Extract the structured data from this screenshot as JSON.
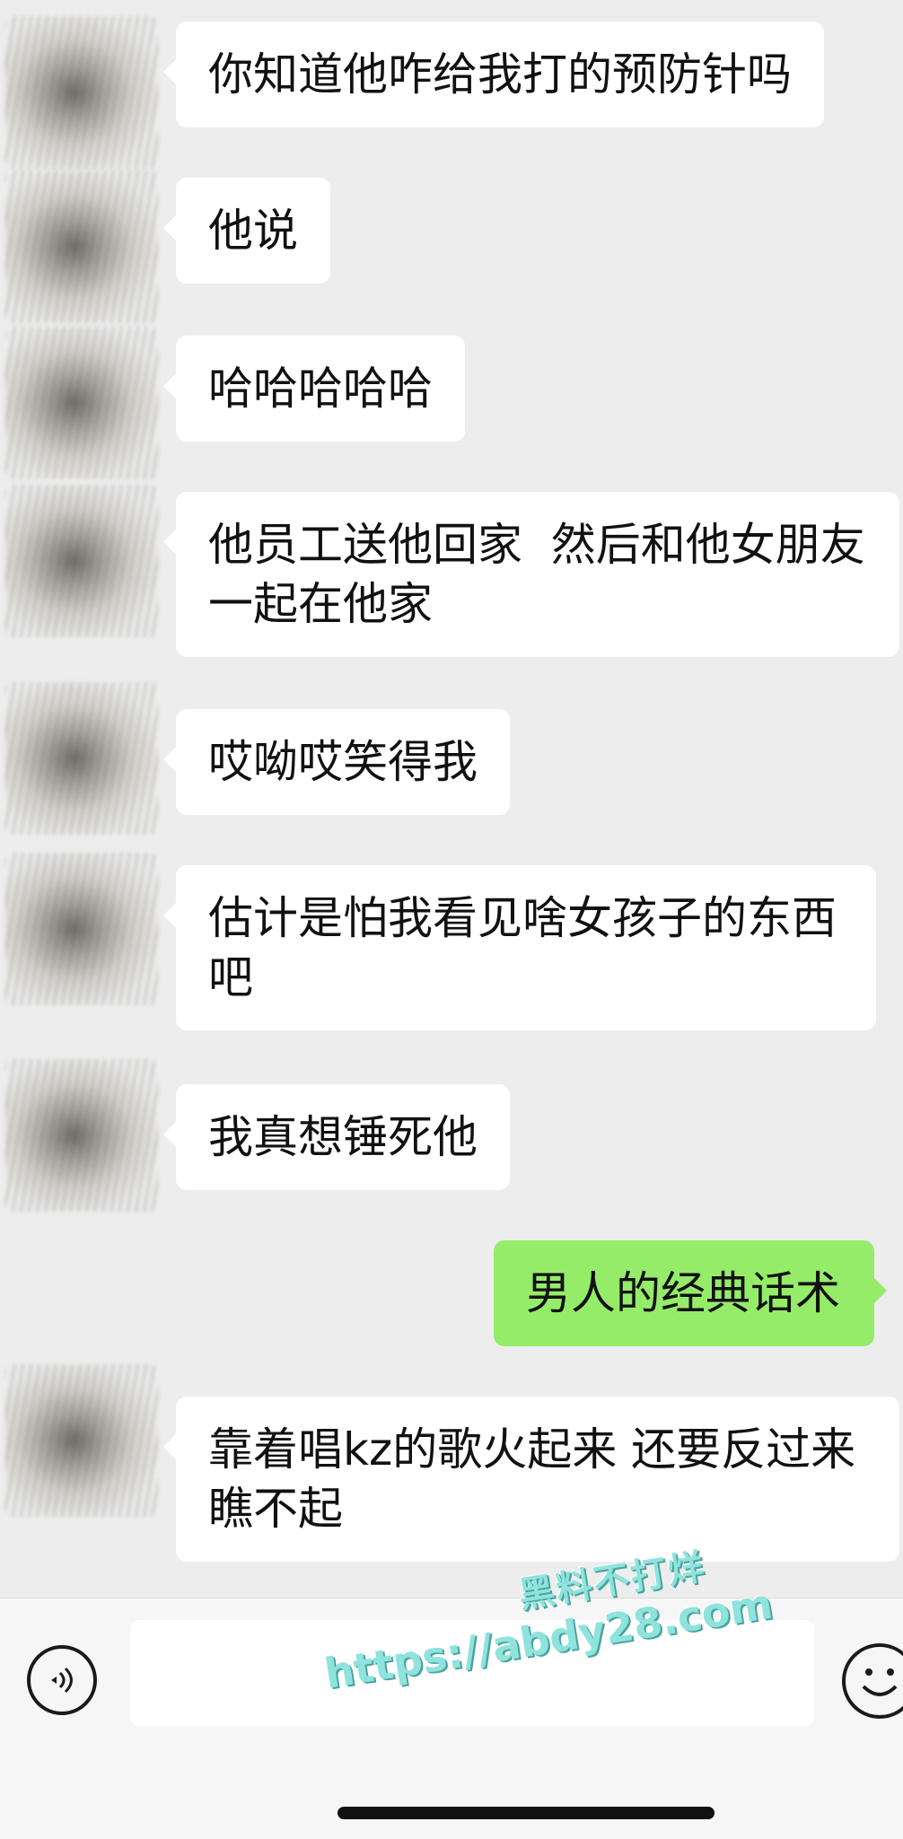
{
  "messages": [
    {
      "side": "left",
      "text": "你知道他咋给我打的预防针吗"
    },
    {
      "side": "left",
      "text": "他说"
    },
    {
      "side": "left",
      "text": "哈哈哈哈哈"
    },
    {
      "side": "left",
      "text": "他员工送他回家  然后和他女朋友\n一起在他家"
    },
    {
      "side": "left",
      "text": "哎呦哎笑得我"
    },
    {
      "side": "left",
      "text": "估计是怕我看见啥女孩子的东西\n吧"
    },
    {
      "side": "left",
      "text": "我真想锤死他"
    },
    {
      "side": "right",
      "text": "男人的经典话术"
    },
    {
      "side": "left",
      "text": "靠着唱kz的歌火起来 还要反过来\n瞧不起"
    }
  ],
  "input_bar": {
    "voice_icon": "voice-icon",
    "emoji_icon": "emoji-icon",
    "input_value": ""
  },
  "watermark": {
    "line1": "黑料不打烊",
    "line2": "https://abdy28.com"
  },
  "colors": {
    "background": "#ededed",
    "left_bubble": "#ffffff",
    "right_bubble": "#95ec69",
    "watermark": "#8fe3dd"
  }
}
